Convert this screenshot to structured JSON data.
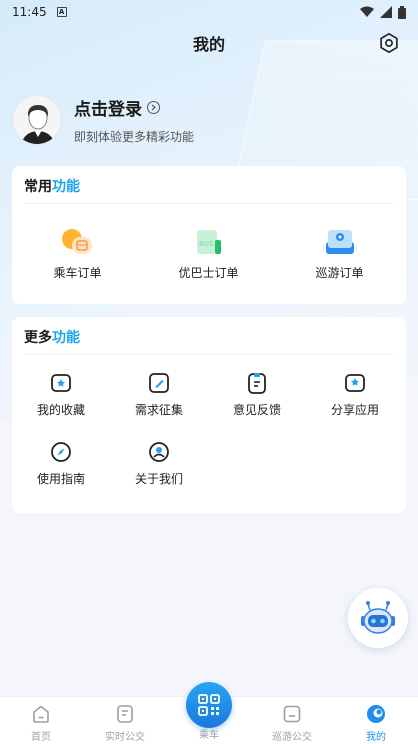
{
  "status_bar": {
    "time": "11:45",
    "sim_label": "A"
  },
  "header": {
    "title": "我的"
  },
  "profile": {
    "login_text": "点击登录",
    "subtitle": "即刻体验更多精彩功能"
  },
  "common": {
    "title_prefix": "常用",
    "title_accent": "功能",
    "items": [
      {
        "label": "乘车订单",
        "icon": "bus-order-icon"
      },
      {
        "label": "优巴士订单",
        "icon": "bus-ticket-icon"
      },
      {
        "label": "巡游订单",
        "icon": "tour-map-icon"
      }
    ]
  },
  "more": {
    "title_prefix": "更多",
    "title_accent": "功能",
    "items": [
      {
        "label": "我的收藏",
        "icon": "favorite-icon"
      },
      {
        "label": "需求征集",
        "icon": "edit-icon"
      },
      {
        "label": "意见反馈",
        "icon": "feedback-icon"
      },
      {
        "label": "分享应用",
        "icon": "share-icon"
      },
      {
        "label": "使用指南",
        "icon": "compass-icon"
      },
      {
        "label": "关于我们",
        "icon": "about-icon"
      }
    ]
  },
  "nav": {
    "items": [
      {
        "label": "首页",
        "icon": "home-icon",
        "active": false
      },
      {
        "label": "实时公交",
        "icon": "realtime-bus-icon",
        "active": false
      },
      {
        "label": "乘车",
        "icon": "qr-code-icon",
        "active": false
      },
      {
        "label": "巡游公交",
        "icon": "tour-bus-icon",
        "active": false
      },
      {
        "label": "我的",
        "icon": "profile-icon",
        "active": true
      }
    ]
  },
  "colors": {
    "accent": "#1da4ea",
    "nav_active": "#1d8fea",
    "nav_inactive": "#9aa0a8"
  }
}
